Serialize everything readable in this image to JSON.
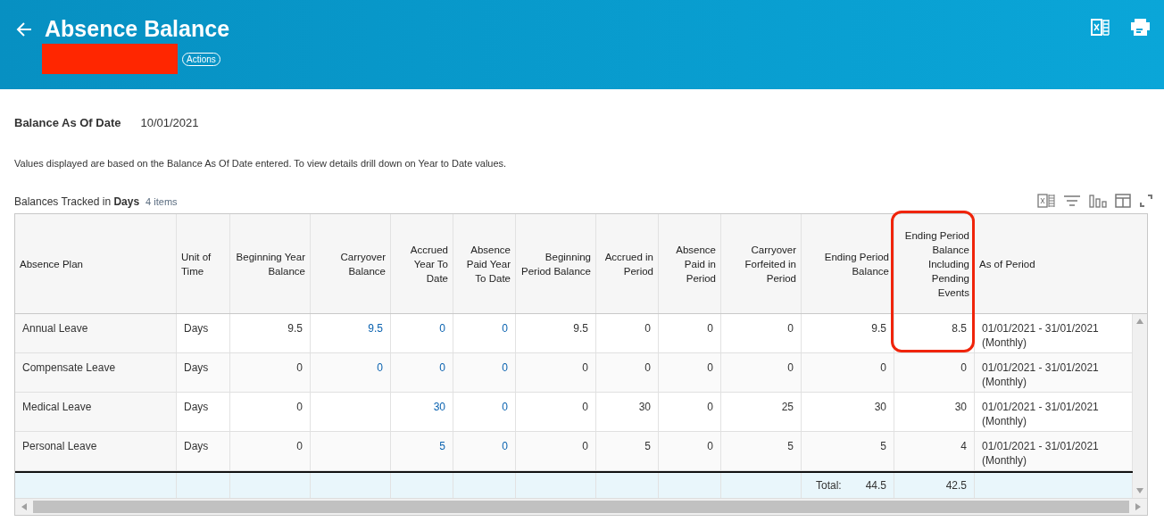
{
  "header": {
    "title": "Absence Balance",
    "actions_label": "Actions",
    "redacted": true
  },
  "balance_date": {
    "label": "Balance As Of Date",
    "value": "10/01/2021"
  },
  "description": "Values displayed are based on the Balance As Of Date entered.  To view details drill down on Year to Date values.",
  "section": {
    "title": "Balances Tracked in **Days**",
    "count": "4 items"
  },
  "table": {
    "columns": [
      {
        "label": "Absence Plan",
        "highlighted": false
      },
      {
        "label": "Unit of Time",
        "highlighted": false
      },
      {
        "label": "Beginning Year Balance",
        "highlighted": false
      },
      {
        "label": "Carryover Balance",
        "highlighted": false
      },
      {
        "label": "Accrued Year To Date",
        "highlighted": false
      },
      {
        "label": "Absence Paid Year To Date",
        "highlighted": false
      },
      {
        "label": "Beginning Period Balance",
        "highlighted": false
      },
      {
        "label": "Accrued in Period",
        "highlighted": false
      },
      {
        "label": "Absence Paid in Period",
        "highlighted": false
      },
      {
        "label": "Carryover Forfeited in Period",
        "highlighted": false
      },
      {
        "label": "Ending Period Balance",
        "highlighted": false
      },
      {
        "label": "Ending Period Balance Including Pending Events",
        "highlighted": true
      },
      {
        "label": "As of Period",
        "highlighted": false
      }
    ],
    "rows": [
      {
        "cells": [
          {
            "text": "Annual Leave",
            "link": false
          },
          {
            "text": "Days",
            "link": false
          },
          {
            "text": "9.5",
            "link": false
          },
          {
            "text": "9.5",
            "link": true
          },
          {
            "text": "0",
            "link": true
          },
          {
            "text": "0",
            "link": true
          },
          {
            "text": "9.5",
            "link": false
          },
          {
            "text": "0",
            "link": false
          },
          {
            "text": "0",
            "link": false
          },
          {
            "text": "0",
            "link": false
          },
          {
            "text": "9.5",
            "link": false
          },
          {
            "text": "8.5",
            "link": false
          },
          {
            "text": "01/01/2021 - 31/01/2021 (Monthly)",
            "link": false
          }
        ]
      },
      {
        "cells": [
          {
            "text": "Compensate Leave",
            "link": false
          },
          {
            "text": "Days",
            "link": false
          },
          {
            "text": "0",
            "link": false
          },
          {
            "text": "0",
            "link": true
          },
          {
            "text": "0",
            "link": true
          },
          {
            "text": "0",
            "link": true
          },
          {
            "text": "0",
            "link": false
          },
          {
            "text": "0",
            "link": false
          },
          {
            "text": "0",
            "link": false
          },
          {
            "text": "0",
            "link": false
          },
          {
            "text": "0",
            "link": false
          },
          {
            "text": "0",
            "link": false
          },
          {
            "text": "01/01/2021 - 31/01/2021 (Monthly)",
            "link": false
          }
        ]
      },
      {
        "cells": [
          {
            "text": "Medical Leave",
            "link": false
          },
          {
            "text": "Days",
            "link": false
          },
          {
            "text": "0",
            "link": false
          },
          null,
          {
            "text": "30",
            "link": true
          },
          {
            "text": "0",
            "link": true
          },
          {
            "text": "0",
            "link": false
          },
          {
            "text": "30",
            "link": false
          },
          {
            "text": "0",
            "link": false
          },
          {
            "text": "25",
            "link": false
          },
          {
            "text": "30",
            "link": false
          },
          {
            "text": "30",
            "link": false
          },
          {
            "text": "01/01/2021 - 31/01/2021 (Monthly)",
            "link": false
          }
        ]
      },
      {
        "cells": [
          {
            "text": "Personal Leave",
            "link": false
          },
          {
            "text": "Days",
            "link": false
          },
          {
            "text": "0",
            "link": false
          },
          null,
          {
            "text": "5",
            "link": true
          },
          {
            "text": "0",
            "link": true
          },
          {
            "text": "0",
            "link": false
          },
          {
            "text": "5",
            "link": false
          },
          {
            "text": "0",
            "link": false
          },
          {
            "text": "5",
            "link": false
          },
          {
            "text": "5",
            "link": false
          },
          {
            "text": "4",
            "link": false
          },
          {
            "text": "01/01/2021 - 31/01/2021 (Monthly)",
            "link": false
          }
        ]
      }
    ],
    "total_row": {
      "label": "Total:",
      "ending_period_balance": "44.5",
      "ending_period_balance_including_pending": "42.5"
    }
  }
}
